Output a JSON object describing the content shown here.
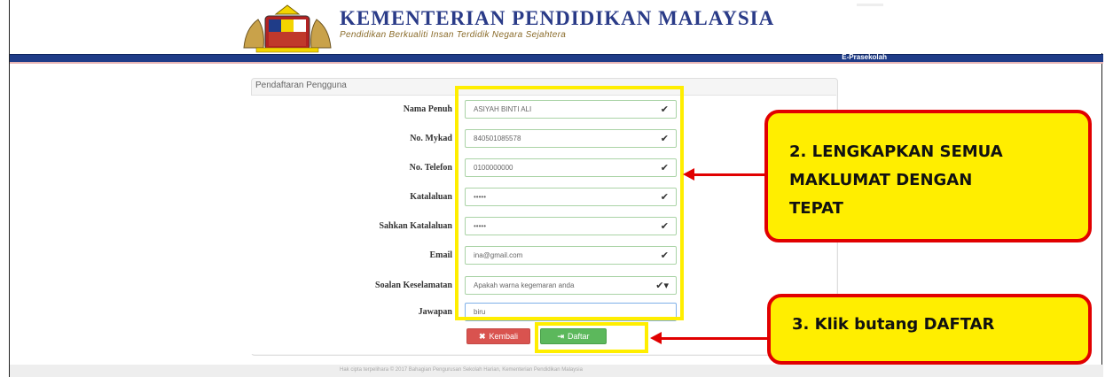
{
  "header": {
    "title": "KEMENTERIAN PENDIDIKAN MALAYSIA",
    "subtitle": "Pendidikan Berkualiti Insan Terdidik Negara Sejahtera",
    "nav_brand": "E-Prasekolah"
  },
  "form": {
    "panel_title": "Pendaftaran Pengguna",
    "fields": [
      {
        "label": "Nama Penuh",
        "value": "ASIYAH BINTI ALI"
      },
      {
        "label": "No. Mykad",
        "value": "840501085578"
      },
      {
        "label": "No. Telefon",
        "value": "0100000000"
      },
      {
        "label": "Katalaluan",
        "value": "•••••"
      },
      {
        "label": "Sahkan Katalaluan",
        "value": "•••••"
      },
      {
        "label": "Email",
        "value": "ina@gmail.com"
      },
      {
        "label": "Soalan Keselamatan",
        "value": "Apakah warna kegemaran anda"
      },
      {
        "label": "Jawapan",
        "value": "biru"
      }
    ],
    "cancel_label": "Kembali",
    "submit_label": "Daftar"
  },
  "annotations": {
    "callout_1_lines": [
      "2. LENGKAPKAN SEMUA",
      "MAKLUMAT DENGAN",
      "TEPAT"
    ],
    "callout_2": "3. Klik butang DAFTAR",
    "highlight_color": "#ffee00",
    "arrow_color": "#e10000"
  },
  "footer": {
    "text": "Hak cipta terpelihara © 2017 Bahagian Pengurusan Sekolah Harian, Kementerian Pendidikan Malaysia"
  }
}
